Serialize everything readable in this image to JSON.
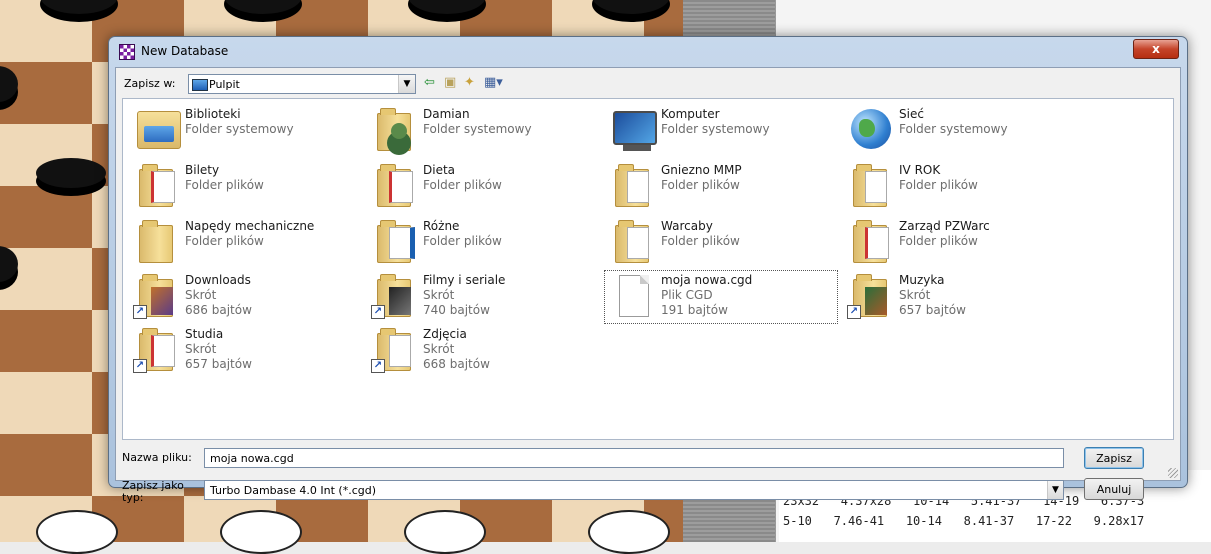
{
  "dialog": {
    "title": "New Database",
    "close_label": "x",
    "save_in_label": "Zapisz w:",
    "save_in_value": "Pulpit",
    "filename_label": "Nazwa pliku:",
    "filename_value": "moja nowa.cgd",
    "filetype_label_1": "Zapisz jako",
    "filetype_label_2": "typ:",
    "filetype_value": "Turbo Dambase 4.0 Int (*.cgd)",
    "save_button": "Zapisz",
    "cancel_button": "Anuluj"
  },
  "toolbar_icons": [
    "back-arrow-icon",
    "up-folder-icon",
    "new-folder-icon",
    "view-menu-icon"
  ],
  "items": [
    {
      "name": "Biblioteki",
      "type": "Folder systemowy",
      "size": "",
      "icon": "library-icon"
    },
    {
      "name": "Damian",
      "type": "Folder systemowy",
      "size": "",
      "icon": "user-folder-icon"
    },
    {
      "name": "Komputer",
      "type": "Folder systemowy",
      "size": "",
      "icon": "computer-icon"
    },
    {
      "name": "Sieć",
      "type": "Folder systemowy",
      "size": "",
      "icon": "network-icon"
    },
    {
      "name": "Bilety",
      "type": "Folder plików",
      "size": "",
      "icon": "folder-icon"
    },
    {
      "name": "Dieta",
      "type": "Folder plików",
      "size": "",
      "icon": "folder-icon"
    },
    {
      "name": "Gniezno MMP",
      "type": "Folder plików",
      "size": "",
      "icon": "folder-icon"
    },
    {
      "name": "IV ROK",
      "type": "Folder plików",
      "size": "",
      "icon": "folder-icon"
    },
    {
      "name": "Napędy mechaniczne",
      "type": "Folder plików",
      "size": "",
      "icon": "folder-icon"
    },
    {
      "name": "Różne",
      "type": "Folder plików",
      "size": "",
      "icon": "folder-icon"
    },
    {
      "name": "Warcaby",
      "type": "Folder plików",
      "size": "",
      "icon": "folder-icon"
    },
    {
      "name": "Zarząd PZWarc",
      "type": "Folder plików",
      "size": "",
      "icon": "folder-icon"
    },
    {
      "name": "Downloads",
      "type": "Skrót",
      "size": "686 bajtów",
      "icon": "shortcut-icon"
    },
    {
      "name": "Filmy i seriale",
      "type": "Skrót",
      "size": "740 bajtów",
      "icon": "shortcut-icon"
    },
    {
      "name": "moja nowa.cgd",
      "type": "Plik CGD",
      "size": "191 bajtów",
      "icon": "file-icon"
    },
    {
      "name": "Muzyka",
      "type": "Skrót",
      "size": "657 bajtów",
      "icon": "shortcut-icon"
    },
    {
      "name": "Studia",
      "type": "Skrót",
      "size": "657 bajtów",
      "icon": "shortcut-icon"
    },
    {
      "name": "Zdjęcia",
      "type": "Skrót",
      "size": "668 bajtów",
      "icon": "shortcut-icon"
    }
  ],
  "movelog": {
    "rows": [
      "23x32   4.37x28   10-14   5.41-37   14-19   6.37-3",
      "5-10   7.46-41   10-14   8.41-37   17-22   9.28x17"
    ]
  }
}
